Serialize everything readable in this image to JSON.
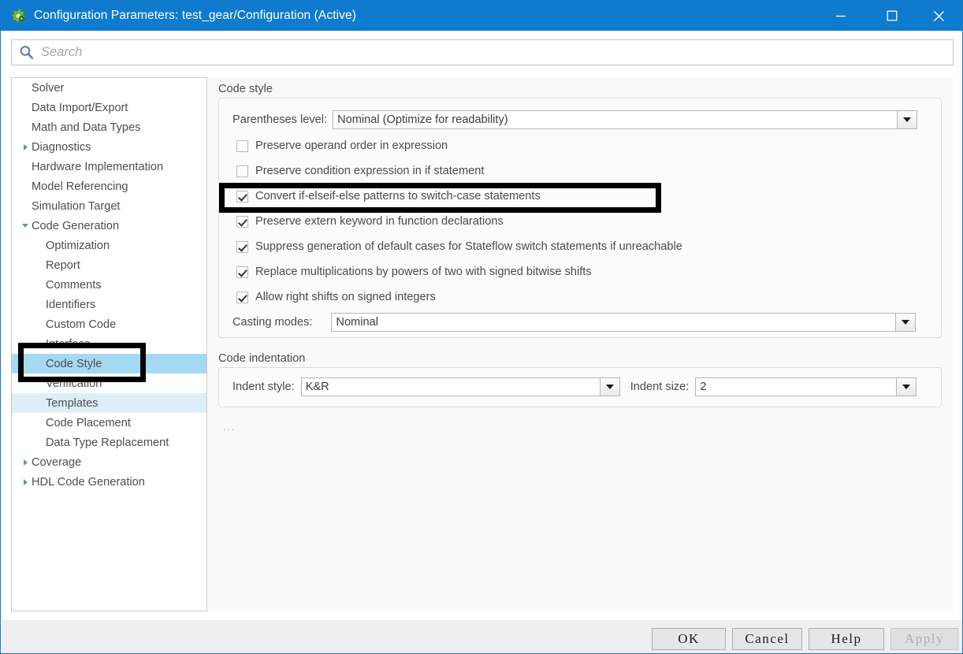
{
  "window": {
    "title": "Configuration Parameters: test_gear/Configuration (Active)",
    "app_icon": "gear-icon",
    "controls": {
      "minimize": "minimize-icon",
      "maximize": "maximize-icon",
      "close": "close-icon"
    },
    "accent_color": "#0e7bce"
  },
  "search": {
    "icon": "search-icon",
    "placeholder": "Search",
    "value": ""
  },
  "sidebar": {
    "items": [
      {
        "label": "Solver",
        "depth": 0,
        "twisty": "none",
        "selected": "none"
      },
      {
        "label": "Data Import/Export",
        "depth": 0,
        "twisty": "none",
        "selected": "none"
      },
      {
        "label": "Math and Data Types",
        "depth": 0,
        "twisty": "none",
        "selected": "none"
      },
      {
        "label": "Diagnostics",
        "depth": 0,
        "twisty": "collapsed",
        "selected": "none"
      },
      {
        "label": "Hardware Implementation",
        "depth": 0,
        "twisty": "none",
        "selected": "none"
      },
      {
        "label": "Model Referencing",
        "depth": 0,
        "twisty": "none",
        "selected": "none"
      },
      {
        "label": "Simulation Target",
        "depth": 0,
        "twisty": "none",
        "selected": "none"
      },
      {
        "label": "Code Generation",
        "depth": 0,
        "twisty": "expanded",
        "selected": "none"
      },
      {
        "label": "Optimization",
        "depth": 1,
        "twisty": "none",
        "selected": "none"
      },
      {
        "label": "Report",
        "depth": 1,
        "twisty": "none",
        "selected": "none"
      },
      {
        "label": "Comments",
        "depth": 1,
        "twisty": "none",
        "selected": "none"
      },
      {
        "label": "Identifiers",
        "depth": 1,
        "twisty": "none",
        "selected": "none"
      },
      {
        "label": "Custom Code",
        "depth": 1,
        "twisty": "none",
        "selected": "none"
      },
      {
        "label": "Interface",
        "depth": 1,
        "twisty": "none",
        "selected": "none"
      },
      {
        "label": "Code Style",
        "depth": 1,
        "twisty": "none",
        "selected": "strong"
      },
      {
        "label": "Verification",
        "depth": 1,
        "twisty": "none",
        "selected": "none"
      },
      {
        "label": "Templates",
        "depth": 1,
        "twisty": "none",
        "selected": "light"
      },
      {
        "label": "Code Placement",
        "depth": 1,
        "twisty": "none",
        "selected": "none"
      },
      {
        "label": "Data Type Replacement",
        "depth": 1,
        "twisty": "none",
        "selected": "none"
      },
      {
        "label": "Coverage",
        "depth": 0,
        "twisty": "collapsed",
        "selected": "none"
      },
      {
        "label": "HDL Code Generation",
        "depth": 0,
        "twisty": "collapsed",
        "selected": "none"
      }
    ],
    "selected_colors": {
      "strong": "#a5d8f3",
      "light": "#ddeefb"
    }
  },
  "main": {
    "code_style": {
      "title": "Code style",
      "parentheses_level": {
        "label": "Parentheses level:",
        "value": "Nominal (Optimize for readability)"
      },
      "checkboxes": [
        {
          "label": "Preserve operand order in expression",
          "checked": false
        },
        {
          "label": "Preserve condition expression in if statement",
          "checked": false
        },
        {
          "label": "Convert if-elseif-else patterns to switch-case statements",
          "checked": true
        },
        {
          "label": "Preserve extern keyword in function declarations",
          "checked": true
        },
        {
          "label": "Suppress generation of default cases for Stateflow switch statements if unreachable",
          "checked": true
        },
        {
          "label": "Replace multiplications by powers of two with signed bitwise shifts",
          "checked": true
        },
        {
          "label": "Allow right shifts on signed integers",
          "checked": true
        }
      ],
      "casting_modes": {
        "label": "Casting modes:",
        "value": "Nominal"
      }
    },
    "code_indentation": {
      "title": "Code indentation",
      "indent_style": {
        "label": "Indent style:",
        "value": "K&R"
      },
      "indent_size": {
        "label": "Indent size:",
        "value": "2"
      }
    },
    "overflow_text": "..."
  },
  "annotations": {
    "sidebar_highlight_target": "Code Style",
    "main_highlight_target": "Convert if-elseif-else patterns to switch-case statements",
    "color": "#000000"
  },
  "footer": {
    "buttons": [
      {
        "label": "OK",
        "enabled": true
      },
      {
        "label": "Cancel",
        "enabled": true
      },
      {
        "label": "Help",
        "enabled": true
      },
      {
        "label": "Apply",
        "enabled": false
      }
    ]
  }
}
